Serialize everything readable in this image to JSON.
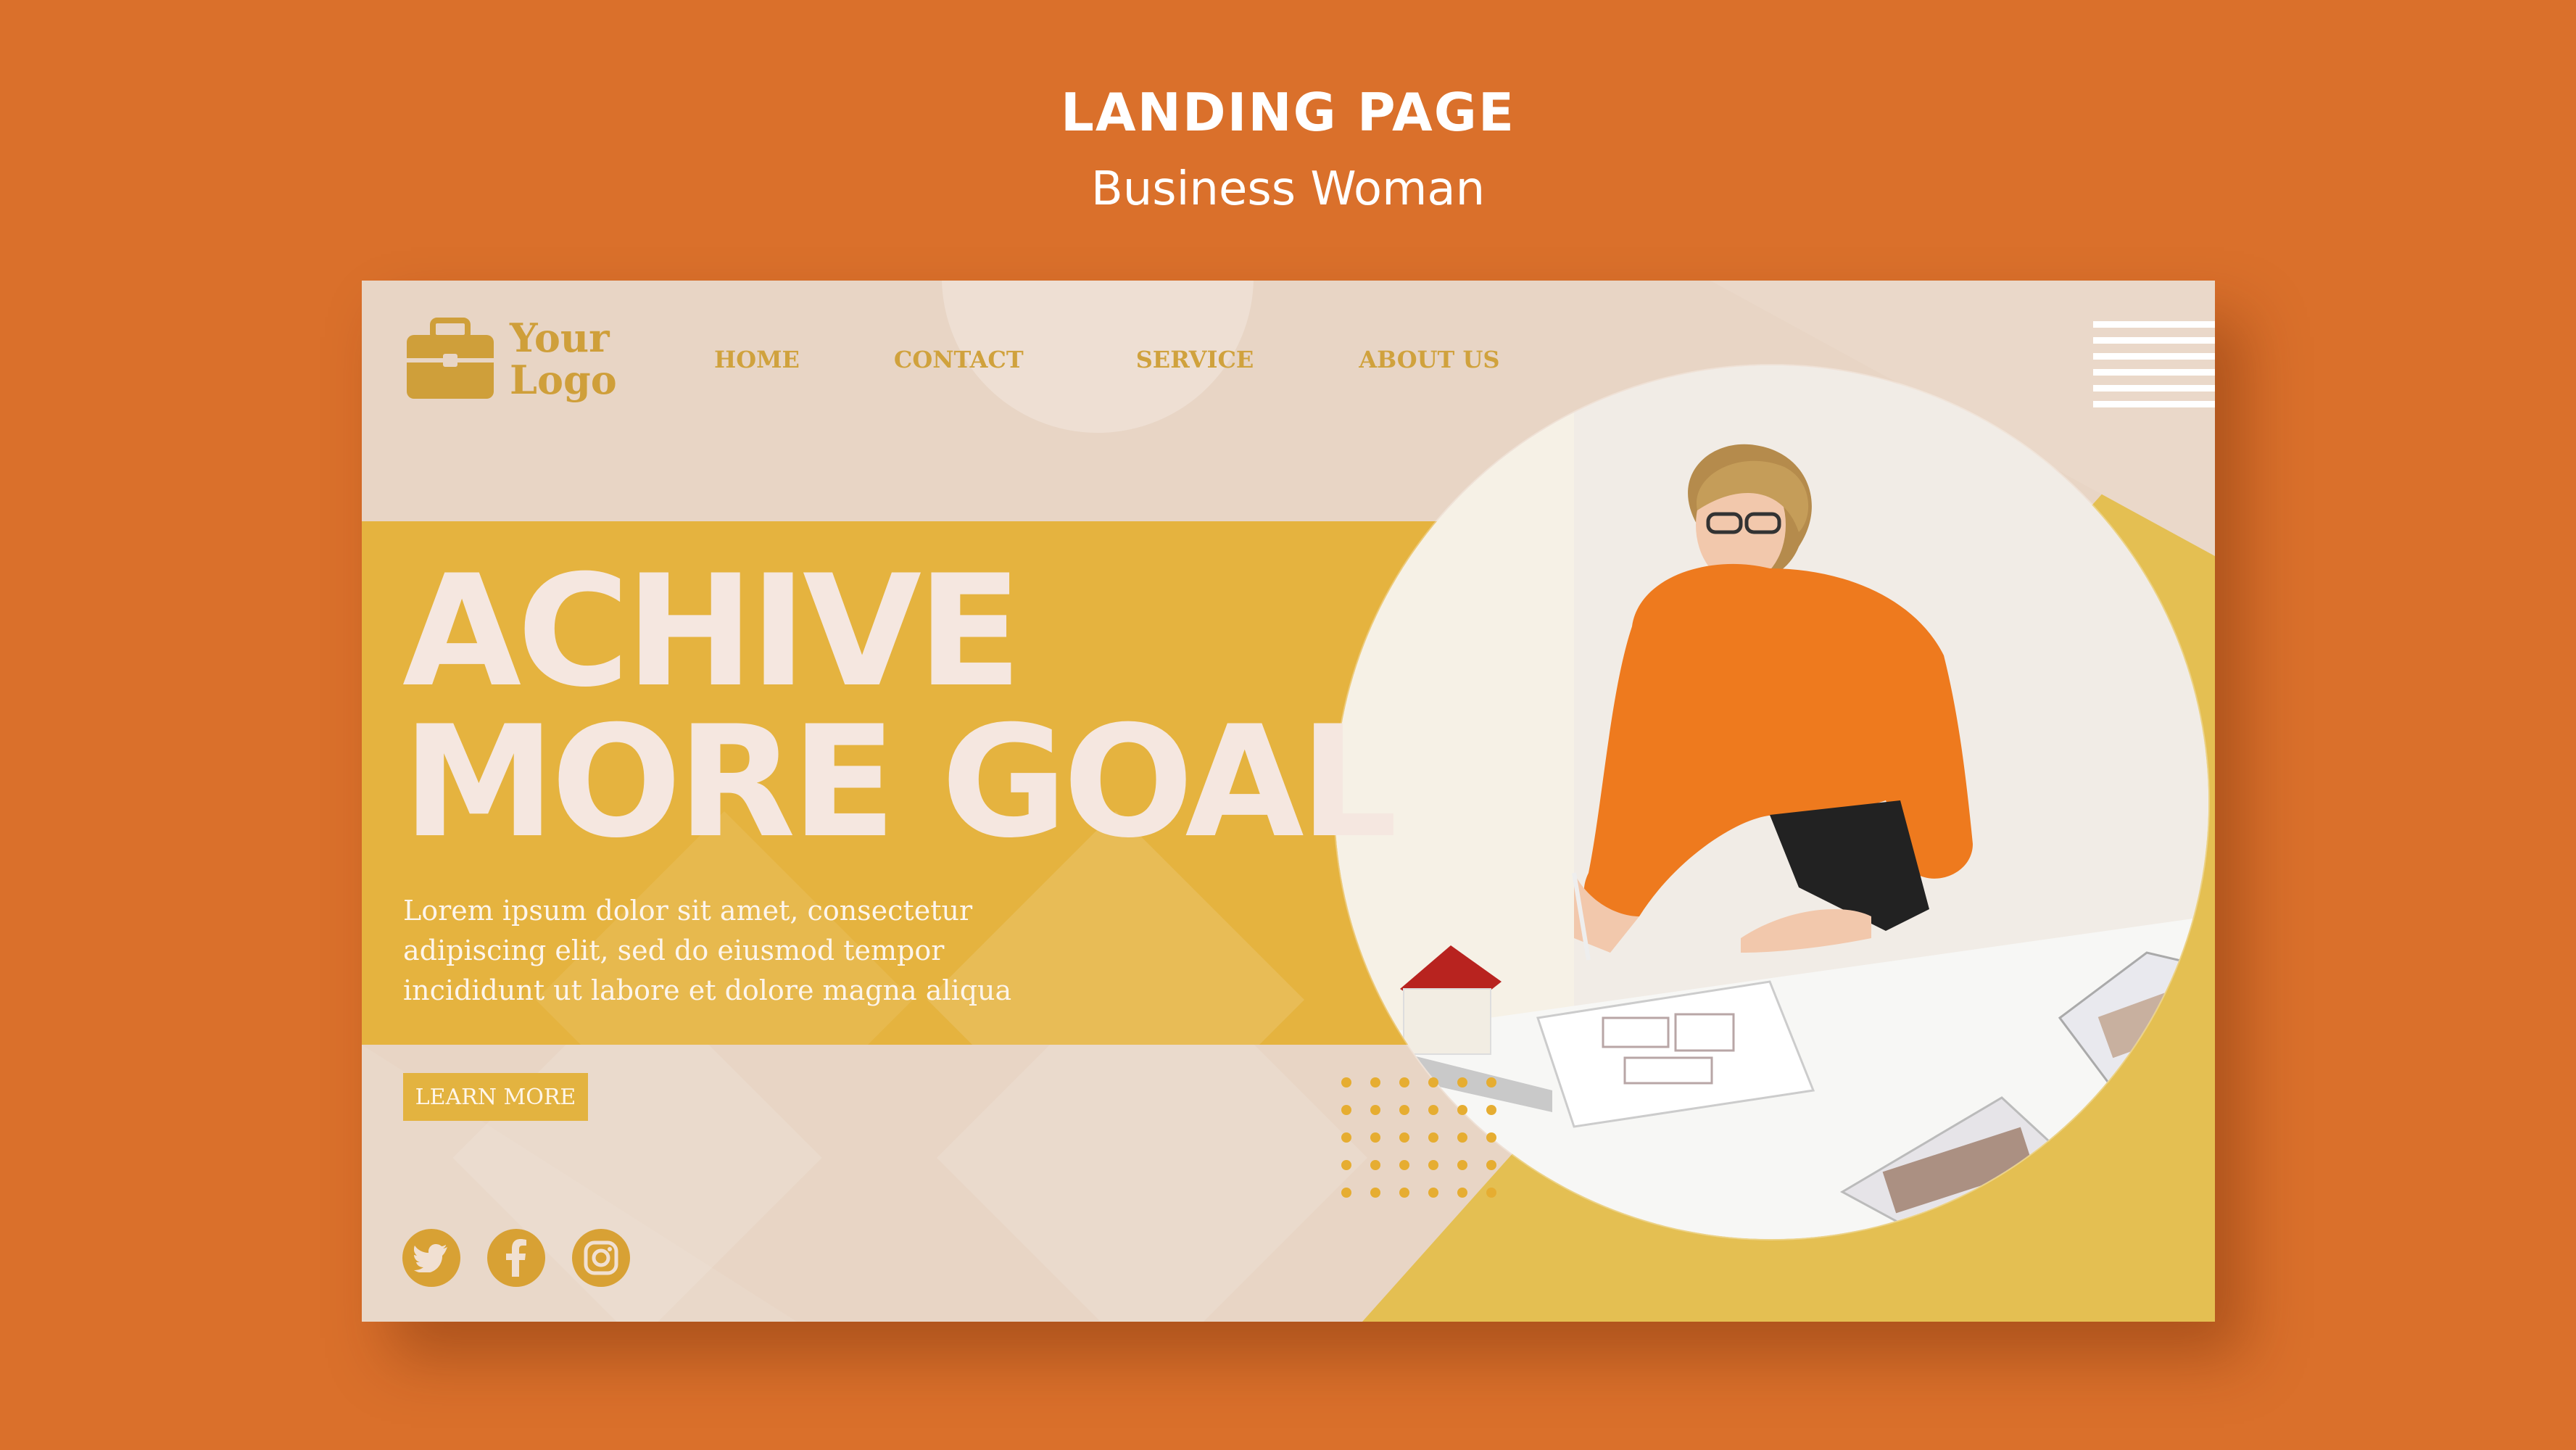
{
  "header": {
    "title": "LANDING PAGE",
    "subtitle": "Business Woman"
  },
  "logo": {
    "line1": "Your",
    "line2": "Logo",
    "icon": "briefcase-icon"
  },
  "nav": {
    "items": [
      {
        "label": "HOME"
      },
      {
        "label": "CONTACT"
      },
      {
        "label": "SERVICE"
      },
      {
        "label": "ABOUT US"
      }
    ]
  },
  "hero": {
    "headline_line1": "ACHIVE",
    "headline_line2": "MORE GOAL",
    "body_line1": "Lorem ipsum dolor sit amet, consectetur",
    "body_line2": "adipiscing elit, sed do eiusmod tempor",
    "body_line3": "incididunt ut labore et dolore magna aliqua",
    "cta_label": "LEARN MORE"
  },
  "socials": [
    {
      "icon": "twitter-icon"
    },
    {
      "icon": "facebook-icon"
    },
    {
      "icon": "instagram-icon"
    }
  ],
  "colors": {
    "background": "#da702b",
    "card": "#e8d5c5",
    "accent_yellow": "#e5b33f",
    "logo_gold": "#cf9f3a",
    "headline": "#f5e7e0",
    "blouse_orange": "#ee7a1e"
  }
}
